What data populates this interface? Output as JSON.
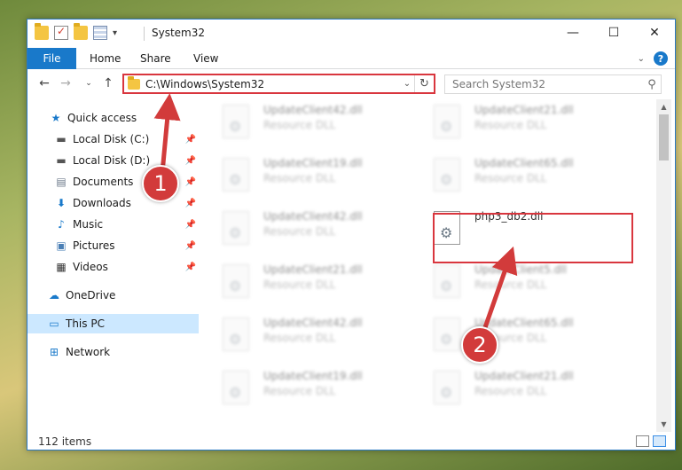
{
  "window": {
    "title": "System32",
    "controls": {
      "minimize": "—",
      "maximize": "☐",
      "close": "✕"
    }
  },
  "ribbon": {
    "tabs": [
      "File",
      "Home",
      "Share",
      "View"
    ],
    "help": "?"
  },
  "address": {
    "path": "C:\\Windows\\System32",
    "search_placeholder": "Search System32"
  },
  "nav": {
    "items": [
      {
        "label": "Quick access",
        "icon": "star-icon",
        "pinned": false
      },
      {
        "label": "Local Disk (C:)",
        "icon": "drive-icon",
        "pinned": true
      },
      {
        "label": "Local Disk (D:)",
        "icon": "drive-icon",
        "pinned": true
      },
      {
        "label": "Documents",
        "icon": "documents-icon",
        "pinned": true
      },
      {
        "label": "Downloads",
        "icon": "downloads-icon",
        "pinned": true
      },
      {
        "label": "Music",
        "icon": "music-icon",
        "pinned": true
      },
      {
        "label": "Pictures",
        "icon": "pictures-icon",
        "pinned": true
      },
      {
        "label": "Videos",
        "icon": "videos-icon",
        "pinned": true
      },
      {
        "label": "OneDrive",
        "icon": "onedrive-icon",
        "pinned": false
      },
      {
        "label": "This PC",
        "icon": "pc-icon",
        "pinned": false,
        "selected": true
      },
      {
        "label": "Network",
        "icon": "network-icon",
        "pinned": false
      }
    ]
  },
  "files": {
    "left": [
      {
        "name": "UpdateClient42.dll",
        "type": "Resource DLL"
      },
      {
        "name": "UpdateClient19.dll",
        "type": "Resource DLL"
      },
      {
        "name": "UpdateClient42.dll",
        "type": "Resource DLL"
      },
      {
        "name": "UpdateClient21.dll",
        "type": "Resource DLL"
      },
      {
        "name": "UpdateClient42.dll",
        "type": "Resource DLL"
      },
      {
        "name": "UpdateClient19.dll",
        "type": "Resource DLL"
      }
    ],
    "right": [
      {
        "name": "UpdateClient21.dll",
        "type": "Resource DLL"
      },
      {
        "name": "UpdateClient65.dll",
        "type": "Resource DLL"
      },
      {
        "name": "php3_db2.dll",
        "type": "",
        "highlighted": true
      },
      {
        "name": "UpdateClient5.dll",
        "type": "Resource DLL"
      },
      {
        "name": "UpdateClient65.dll",
        "type": "Resource DLL"
      },
      {
        "name": "UpdateClient21.dll",
        "type": "Resource DLL"
      }
    ]
  },
  "status": {
    "item_count": "112 items"
  },
  "annotations": {
    "marker1": "1",
    "marker2": "2",
    "color": "#d23b3b"
  }
}
